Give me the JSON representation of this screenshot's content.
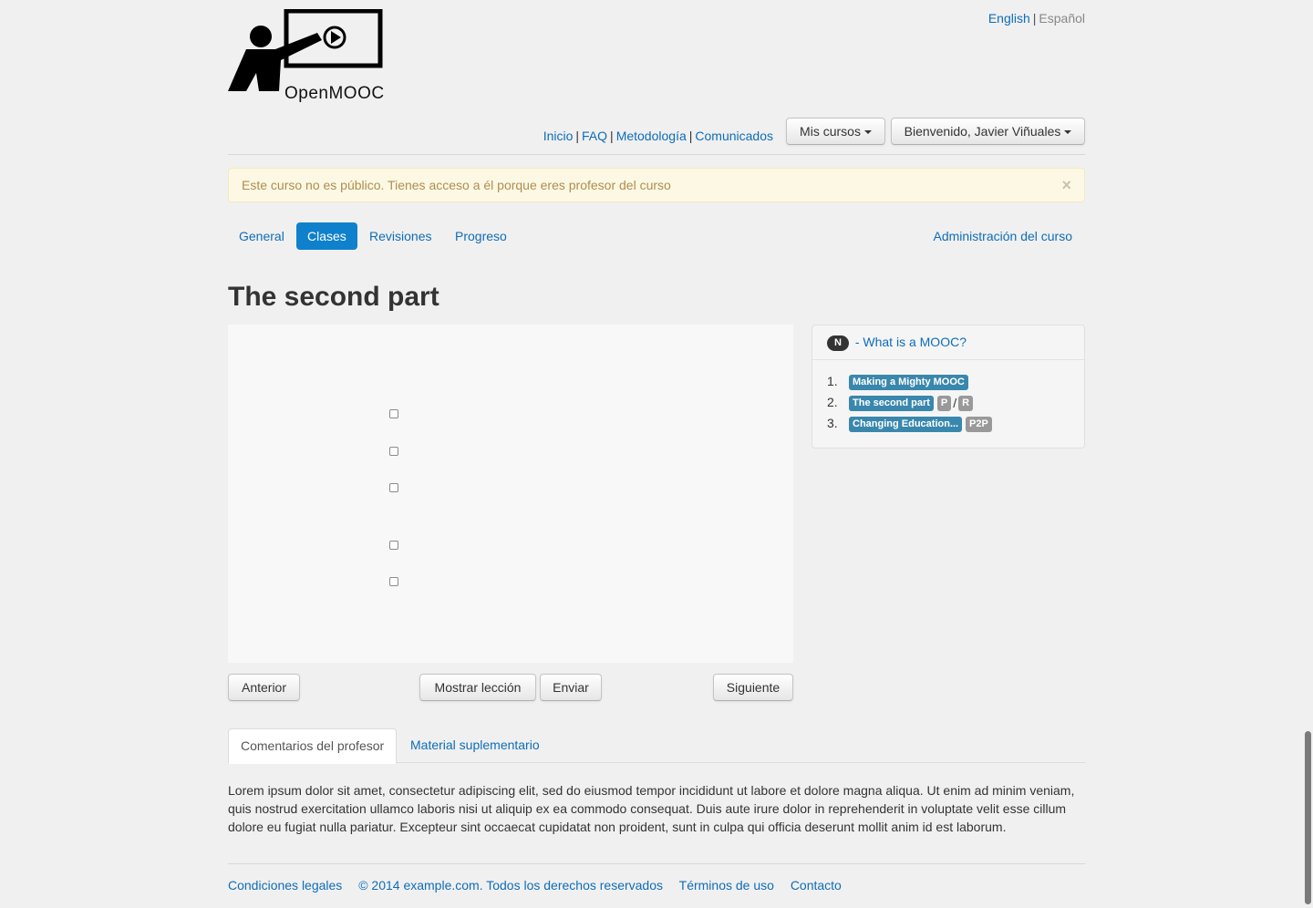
{
  "brand": {
    "name": "OpenMOOC"
  },
  "language": {
    "english": "English",
    "separator": "|",
    "spanish": "Español"
  },
  "nav": {
    "links": [
      "Inicio",
      "FAQ",
      "Metodología",
      "Comunicados"
    ],
    "my_courses": "Mis cursos",
    "welcome": "Bienvenido, Javier Viñuales"
  },
  "alert": {
    "text": "Este curso no es público. Tienes acceso a él porque eres profesor del curso",
    "close": "×"
  },
  "course_tabs": {
    "items": [
      "General",
      "Clases",
      "Revisiones",
      "Progreso"
    ],
    "active": "Clases",
    "admin": "Administración del curso"
  },
  "page_title": "The second part",
  "content": {
    "checkboxes": 5
  },
  "actions": {
    "prev": "Anterior",
    "show_lesson": "Mostrar lección",
    "submit": "Enviar",
    "next": "Siguiente"
  },
  "sidebar": {
    "badge": "N",
    "title": "- What is a MOOC?",
    "lessons": [
      {
        "num": "1.",
        "label": "Making a Mighty MOOC",
        "tags": []
      },
      {
        "num": "2.",
        "label": "The second part",
        "tags": [
          "P",
          "R"
        ],
        "tag_separator": "/"
      },
      {
        "num": "3.",
        "label": "Changing Education...",
        "tags": [
          "P2P"
        ]
      }
    ]
  },
  "bottom_tabs": {
    "items": [
      "Comentarios del profesor",
      "Material suplementario"
    ],
    "active": "Comentarios del profesor"
  },
  "comment_text": "Lorem ipsum dolor sit amet, consectetur adipiscing elit, sed do eiusmod tempor incididunt ut labore et dolore magna aliqua. Ut enim ad minim veniam, quis nostrud exercitation ullamco laboris nisi ut aliquip ex ea commodo consequat. Duis aute irure dolor in reprehenderit in voluptate velit esse cillum dolore eu fugiat nulla pariatur. Excepteur sint occaecat cupidatat non proident, sunt in culpa qui officia deserunt mollit anim id est laborum.",
  "footer": {
    "links": [
      "Condiciones legales",
      "© 2014 example.com. Todos los derechos reservados",
      "Términos de uso",
      "Contacto"
    ]
  },
  "colors": {
    "link": "#0f6db7",
    "active_tab": "#0f81cc",
    "label": "#3a87ad",
    "alert_bg": "#fcf8e3"
  }
}
